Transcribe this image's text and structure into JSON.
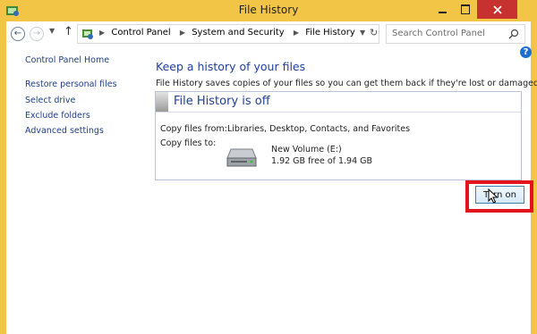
{
  "window": {
    "title": "File History"
  },
  "address_bar": {
    "crumbs": [
      "Control Panel",
      "System and Security",
      "File History"
    ],
    "search_placeholder": "Search Control Panel"
  },
  "sidebar": {
    "home": "Control Panel Home",
    "items": [
      {
        "label": "Restore personal files"
      },
      {
        "label": "Select drive"
      },
      {
        "label": "Exclude folders"
      },
      {
        "label": "Advanced settings"
      }
    ]
  },
  "main": {
    "heading": "Keep a history of your files",
    "description": "File History saves copies of your files so you can get them back if they're lost or damaged.",
    "status_title": "File History is off",
    "copy_from_label": "Copy files from:",
    "copy_from_value": "Libraries, Desktop, Contacts, and Favorites",
    "copy_to_label": "Copy files to:",
    "drive_name": "New Volume (E:)",
    "drive_space": "1.92 GB free of 1.94 GB",
    "turn_on_label": "Turn on"
  },
  "colors": {
    "title_bar": "#f2c546",
    "close_button": "#c7312f",
    "link": "#1f3f86",
    "heading": "#1f3f9a",
    "highlight": "#e3141b"
  },
  "icons": {
    "app": "file-history-icon",
    "minimize": "minimize-icon",
    "maximize": "maximize-icon",
    "close": "close-icon",
    "back": "back-arrow-icon",
    "forward": "forward-arrow-icon",
    "recent": "chevron-down-icon",
    "up": "up-arrow-icon",
    "address": "control-panel-icon",
    "refresh": "refresh-icon",
    "search": "search-icon",
    "help": "help-icon",
    "drive": "hard-drive-icon",
    "cursor": "mouse-cursor-icon"
  }
}
